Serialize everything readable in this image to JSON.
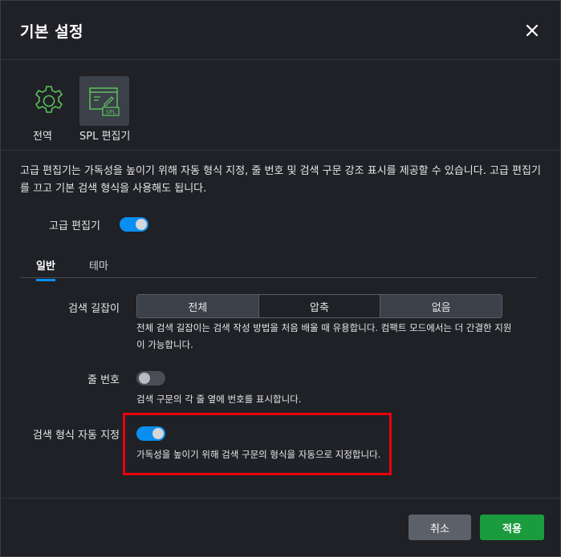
{
  "dialog": {
    "title": "기본 설정",
    "close_icon": "close-icon"
  },
  "apps": [
    {
      "label": "전역",
      "icon": "gear-icon",
      "selected": false
    },
    {
      "label": "SPL 편집기",
      "icon": "spl-editor-icon",
      "selected": true
    }
  ],
  "description": "고급 편집기는 가독성을 높이기 위해 자동 형식 지정, 줄 번호 및 검색 구문 강조 표시를 제공할 수 있습니다. 고급 편집기를 끄고 기본 검색 형식을 사용해도 됩니다.",
  "advanced_editor": {
    "label": "고급 편집기",
    "enabled": true
  },
  "tabs": [
    {
      "label": "일반",
      "active": true
    },
    {
      "label": "테마",
      "active": false
    }
  ],
  "search_assistant": {
    "label": "검색 길잡이",
    "options": [
      "전체",
      "압축",
      "없음"
    ],
    "selected": "압축",
    "help": "전체 검색 길잡이는 검색 작성 방법을 처음 배울 때 유용합니다. 컴팩트 모드에서는 더 간결한 지원이 가능합니다."
  },
  "line_numbers": {
    "label": "줄 번호",
    "enabled": false,
    "help": "검색 구문의 각 줄 옆에 번호를 표시합니다."
  },
  "auto_format": {
    "label": "검색 형식 자동 지정",
    "enabled": true,
    "help": "가독성을 높이기 위해 검색 구문의 형식을 자동으로 지정합니다."
  },
  "footer": {
    "cancel_label": "취소",
    "apply_label": "적용"
  },
  "colors": {
    "accent": "#0a8ef0",
    "apply": "#1a9c3e",
    "icon_green": "#5cc05c",
    "highlight": "#e8000b"
  }
}
